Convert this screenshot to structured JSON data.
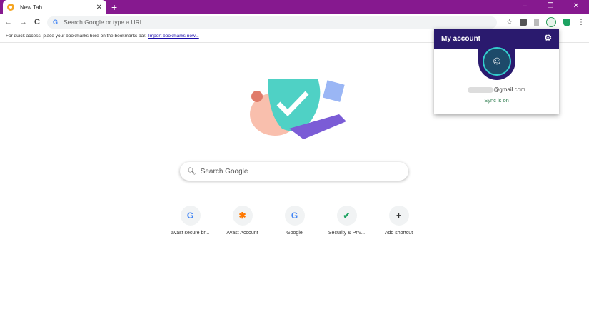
{
  "tab": {
    "title": "New Tab",
    "close": "✕",
    "new": "+"
  },
  "window": {
    "minimize": "–",
    "restore": "❐",
    "close": "✕"
  },
  "toolbar": {
    "back": "←",
    "forward": "→",
    "reload": "C",
    "omnibox_placeholder": "Search Google or type a URL",
    "g": "G",
    "star": "☆",
    "menu": "⋮"
  },
  "bookmarks": {
    "hint": "For quick access, place your bookmarks here on the bookmarks bar.",
    "import_link": "Import bookmarks now..."
  },
  "search": {
    "placeholder": "Search Google"
  },
  "shortcuts": [
    {
      "label": "avast secure br...",
      "glyph": "G",
      "color": "#4285f4"
    },
    {
      "label": "Avast Account",
      "glyph": "✱",
      "color": "#ff7800"
    },
    {
      "label": "Google",
      "glyph": "G",
      "color": "#4285f4"
    },
    {
      "label": "Security & Priv...",
      "glyph": "✔",
      "color": "#1ea362"
    },
    {
      "label": "Add shortcut",
      "glyph": "+",
      "color": "#333"
    }
  ],
  "account_popup": {
    "title": "My account",
    "gear": "⚙",
    "email_suffix": "@gmail.com",
    "sync_status": "Sync is on"
  }
}
